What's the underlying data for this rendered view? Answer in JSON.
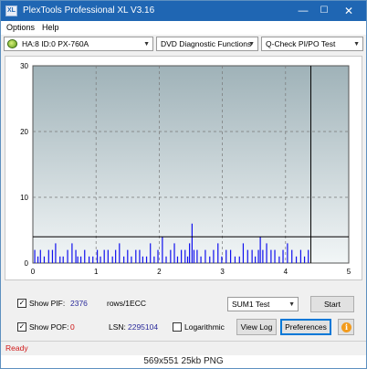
{
  "window": {
    "title": "PlexTools Professional XL V3.16",
    "app_icon_text": "XL"
  },
  "window_controls": {
    "minimize": "—",
    "maximize": "☐",
    "close": "✕"
  },
  "menu": {
    "items": [
      "Options",
      "Help"
    ]
  },
  "toolbar": {
    "drive": "HA:8 ID:0  PX-760A",
    "function": "DVD Diagnostic Functions",
    "test": "Q-Check PI/PO Test",
    "dropdown_arrow": "▼"
  },
  "chart_data": {
    "type": "bar",
    "title": "",
    "xlabel": "",
    "ylabel": "",
    "xlim": [
      0,
      5
    ],
    "ylim": [
      0,
      30
    ],
    "x_ticks": [
      "0",
      "1",
      "2",
      "3",
      "4",
      "5"
    ],
    "y_ticks": [
      "30",
      "20",
      "10",
      "0"
    ],
    "threshold_line": 4,
    "end_marker_x": 4.4,
    "grid": true,
    "colors": {
      "bars": "#1111ee",
      "threshold": "#000000",
      "background_top": "#9fb2b8",
      "background_bottom": "#f2f6f7"
    },
    "series": [
      {
        "x": [
          0.03,
          0.08,
          0.12,
          0.18,
          0.25,
          0.31,
          0.36,
          0.43,
          0.48,
          0.55,
          0.62,
          0.68,
          0.71,
          0.76,
          0.82,
          0.89,
          0.95,
          1.02,
          1.07,
          1.13,
          1.19,
          1.26,
          1.31,
          1.37,
          1.44,
          1.5,
          1.56,
          1.63,
          1.69,
          1.74,
          1.8,
          1.86,
          1.92,
          1.98,
          2.05,
          2.11,
          2.18,
          2.24,
          2.29,
          2.35,
          2.41,
          2.45,
          2.48,
          2.52,
          2.55,
          2.6,
          2.66,
          2.73,
          2.8,
          2.86,
          2.93,
          2.99,
          3.06,
          3.13,
          3.2,
          3.27,
          3.33,
          3.4,
          3.47,
          3.52,
          3.57,
          3.6,
          3.64,
          3.7,
          3.77,
          3.83,
          3.9,
          3.96,
          4.03,
          4.1,
          4.17,
          4.24,
          4.3,
          4.36
        ],
        "values": [
          2,
          1,
          2,
          1,
          2,
          2,
          3,
          1,
          1,
          2,
          3,
          2,
          1,
          1,
          2,
          1,
          1,
          2,
          1,
          2,
          2,
          1,
          2,
          3,
          1,
          2,
          1,
          2,
          2,
          1,
          1,
          3,
          1,
          2,
          4,
          1,
          2,
          3,
          1,
          2,
          2,
          1,
          3,
          6,
          2,
          2,
          1,
          2,
          1,
          2,
          3,
          1,
          2,
          2,
          1,
          1,
          3,
          2,
          2,
          1,
          2,
          4,
          2,
          3,
          2,
          2,
          1,
          2,
          3,
          2,
          1,
          2,
          1,
          2
        ]
      }
    ]
  },
  "controls": {
    "show_pif_label": "Show PIF:",
    "pif_value": "2376",
    "rows_label": "rows/1ECC",
    "show_pof_label": "Show POF:",
    "pof_value": "0",
    "lsn_label": "LSN:",
    "lsn_value": "2295104",
    "logarithmic_label": "Logarithmic",
    "sum_test": "SUM1 Test",
    "start_button": "Start",
    "view_log_button": "View Log",
    "preferences_button": "Preferences",
    "info_icon_glyph": "i",
    "checked_glyph": "✓"
  },
  "status": {
    "text": "Ready"
  },
  "caption": {
    "text": "569x551  25kb  PNG"
  }
}
